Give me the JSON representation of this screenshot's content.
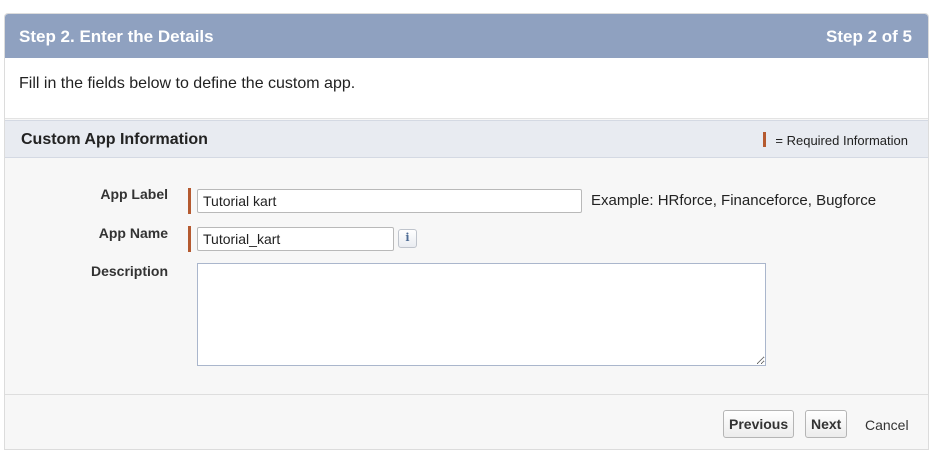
{
  "header": {
    "title": "Step 2. Enter the Details",
    "step": "Step 2 of 5"
  },
  "intro": "Fill in the fields below to define the custom app.",
  "section": {
    "title": "Custom App Information",
    "required_legend": "= Required Information"
  },
  "fields": {
    "app_label": {
      "label": "App Label",
      "value": "Tutorial kart",
      "example": "Example: HRforce, Financeforce, Bugforce"
    },
    "app_name": {
      "label": "App Name",
      "value": "Tutorial_kart"
    },
    "description": {
      "label": "Description",
      "value": ""
    }
  },
  "info_icon_glyph": "i",
  "buttons": {
    "previous": "Previous",
    "next": "Next",
    "cancel": "Cancel"
  },
  "colors": {
    "header": "#8fa1c0",
    "required": "#b55a30",
    "section": "#e8ebf1"
  }
}
